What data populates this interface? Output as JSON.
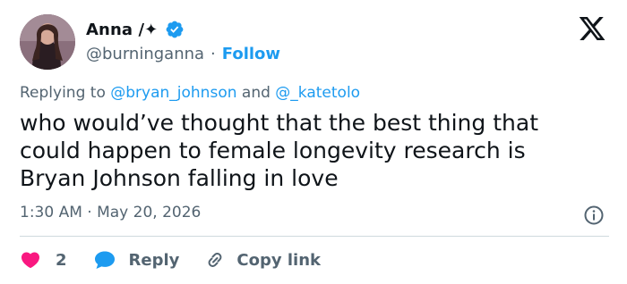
{
  "author": {
    "display_name": "Anna /✦",
    "handle": "@burninganna",
    "separator": "·",
    "follow_label": "Follow"
  },
  "reply_context": {
    "prefix": "Replying to ",
    "user1": "@bryan_johnson",
    "conjunction": " and ",
    "user2": "@_katetolo"
  },
  "tweet": {
    "text": "who would’ve thought that the best thing that\ncould happen to female longevity research is\nBryan Johnson falling in love",
    "timestamp": "1:30 AM · May 20, 2026"
  },
  "actions": {
    "like_count": "2",
    "reply_label": "Reply",
    "copy_label": "Copy link"
  },
  "colors": {
    "accent": "#1d9bf0",
    "like": "#f91880",
    "text": "#0f1419",
    "muted": "#536471"
  },
  "icons": [
    "verified-badge-icon",
    "x-logo-icon",
    "info-icon",
    "heart-icon",
    "reply-bubble-icon",
    "link-icon"
  ]
}
